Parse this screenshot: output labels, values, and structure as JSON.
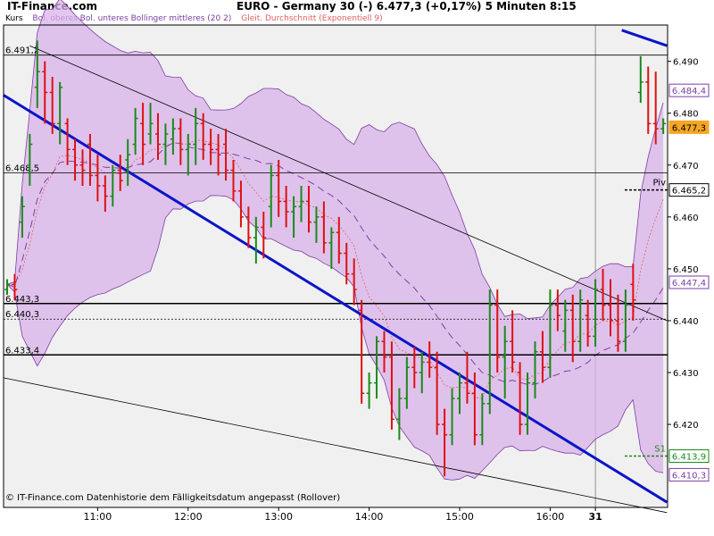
{
  "header": {
    "brand": "IT-Finance.com",
    "title": "EURO - Germany 30 (-)   6.477,3 (+0,17%)    5 Minuten  8:15"
  },
  "legend": [
    {
      "label": "Kurs",
      "color": "#000000"
    },
    {
      "label": "Bol. oberes Bol. unteres Bollinger mittleres (20 2)",
      "color": "#9933cc"
    },
    {
      "label": "Gleit. Durchschnitt (Exponentiell 9)",
      "color": "#e08080"
    }
  ],
  "footer": "© IT-Finance.com  Datenhistorie dem Fälligkeitsdatum angepasst (Rollover)",
  "colors": {
    "up": "#1a8a1a",
    "down": "#dd1111",
    "band_fill": "#d9b3ea",
    "band_line": "#7b3fa3",
    "ema": "#e06060",
    "trend": "#0a14c8",
    "plot_bg": "#f0f0f0",
    "last_price_bg": "#f5a623"
  },
  "chart_data": {
    "type": "candlestick",
    "ylim": [
      6404,
      6497
    ],
    "y_ticks": [
      "6.490",
      "6.480",
      "6.470",
      "6.460",
      "6.450",
      "6.440",
      "6.430",
      "6.420"
    ],
    "y_tick_values": [
      6490,
      6480,
      6470,
      6460,
      6450,
      6440,
      6430,
      6420
    ],
    "x_ticks": [
      "11:00",
      "12:00",
      "13:00",
      "14:00",
      "15:00",
      "16:00",
      "31"
    ],
    "x_tick_index": [
      12,
      24,
      36,
      48,
      60,
      72,
      78
    ],
    "levels": [
      {
        "label": "6.491,2",
        "value": 6491.2,
        "style": "solid"
      },
      {
        "label": "6.468,5",
        "value": 6468.5,
        "style": "solid"
      },
      {
        "label": "6.443,3",
        "value": 6443.3,
        "style": "solid-bold"
      },
      {
        "label": "6.440,3",
        "value": 6440.3,
        "style": "dotted"
      },
      {
        "label": "6.433,4",
        "value": 6433.4,
        "style": "solid-bold"
      }
    ],
    "right_labels": [
      {
        "label": "6.484,4",
        "value": 6484.4,
        "type": "upper-band"
      },
      {
        "label": "6.477,3",
        "value": 6477.3,
        "type": "last"
      },
      {
        "label": "6.465,2",
        "value": 6465.2,
        "type": "pivot",
        "tag": "Piv"
      },
      {
        "label": "6.447,4",
        "value": 6447.4,
        "type": "upper-band"
      },
      {
        "label": "6.413,9",
        "value": 6413.9,
        "type": "support",
        "tag": "S1"
      },
      {
        "label": "6.410,3",
        "value": 6410.3,
        "type": "lower-band"
      }
    ],
    "ohlc": [
      [
        6446,
        6448,
        6445,
        6447
      ],
      [
        6447,
        6449,
        6444,
        6446
      ],
      [
        6459,
        6464,
        6456,
        6462
      ],
      [
        6469,
        6476,
        6466,
        6474
      ],
      [
        6485,
        6494,
        6481,
        6488
      ],
      [
        6488,
        6490,
        6478,
        6484
      ],
      [
        6484,
        6487,
        6476,
        6478
      ],
      [
        6478,
        6486,
        6474,
        6485
      ],
      [
        6478,
        6479,
        6470,
        6473
      ],
      [
        6473,
        6475,
        6467,
        6470
      ],
      [
        6470,
        6473,
        6466,
        6469
      ],
      [
        6474,
        6476,
        6466,
        6468
      ],
      [
        6468,
        6472,
        6463,
        6466
      ],
      [
        6466,
        6468,
        6461,
        6464
      ],
      [
        6464,
        6470,
        6462,
        6469
      ],
      [
        6469,
        6472,
        6465,
        6467
      ],
      [
        6471,
        6475,
        6466,
        6472
      ],
      [
        6474,
        6481,
        6472,
        6479
      ],
      [
        6478,
        6482,
        6470,
        6474
      ],
      [
        6476,
        6482,
        6474,
        6478
      ],
      [
        6476,
        6480,
        6471,
        6474
      ],
      [
        6474,
        6478,
        6470,
        6476
      ],
      [
        6475,
        6479,
        6472,
        6477
      ],
      [
        6477,
        6479,
        6470,
        6473
      ],
      [
        6473,
        6476,
        6468,
        6474
      ],
      [
        6474,
        6481,
        6470,
        6478
      ],
      [
        6478,
        6480,
        6471,
        6474
      ],
      [
        6474,
        6477,
        6470,
        6473
      ],
      [
        6473,
        6476,
        6468,
        6472
      ],
      [
        6474,
        6477,
        6467,
        6469
      ],
      [
        6469,
        6471,
        6463,
        6465
      ],
      [
        6465,
        6467,
        6458,
        6460
      ],
      [
        6460,
        6462,
        6454,
        6456
      ],
      [
        6456,
        6460,
        6451,
        6458
      ],
      [
        6458,
        6461,
        6452,
        6456
      ],
      [
        6462,
        6470,
        6458,
        6468
      ],
      [
        6468,
        6471,
        6460,
        6463
      ],
      [
        6463,
        6466,
        6458,
        6461
      ],
      [
        6461,
        6464,
        6456,
        6462
      ],
      [
        6462,
        6466,
        6459,
        6463
      ],
      [
        6463,
        6466,
        6457,
        6459
      ],
      [
        6459,
        6462,
        6455,
        6460
      ],
      [
        6460,
        6463,
        6453,
        6455
      ],
      [
        6455,
        6458,
        6450,
        6457
      ],
      [
        6457,
        6460,
        6451,
        6453
      ],
      [
        6453,
        6455,
        6447,
        6449
      ],
      [
        6449,
        6452,
        6443,
        6446
      ],
      [
        6442,
        6444,
        6424,
        6426
      ],
      [
        6426,
        6430,
        6423,
        6428
      ],
      [
        6428,
        6437,
        6425,
        6436
      ],
      [
        6436,
        6438,
        6430,
        6433
      ],
      [
        6433,
        6436,
        6419,
        6421
      ],
      [
        6421,
        6427,
        6417,
        6425
      ],
      [
        6425,
        6433,
        6423,
        6431
      ],
      [
        6431,
        6435,
        6427,
        6430
      ],
      [
        6430,
        6434,
        6426,
        6432
      ],
      [
        6432,
        6436,
        6429,
        6431
      ],
      [
        6431,
        6434,
        6418,
        6420
      ],
      [
        6420,
        6423,
        6410,
        6418
      ],
      [
        6418,
        6427,
        6416,
        6425
      ],
      [
        6425,
        6430,
        6422,
        6428
      ],
      [
        6428,
        6434,
        6424,
        6426
      ],
      [
        6426,
        6430,
        6416,
        6418
      ],
      [
        6418,
        6426,
        6416,
        6424
      ],
      [
        6424,
        6446,
        6422,
        6443
      ],
      [
        6443,
        6446,
        6430,
        6433
      ],
      [
        6433,
        6439,
        6425,
        6436
      ],
      [
        6436,
        6442,
        6430,
        6432
      ],
      [
        6430,
        6432,
        6418,
        6420
      ],
      [
        6420,
        6430,
        6418,
        6428
      ],
      [
        6428,
        6436,
        6425,
        6434
      ],
      [
        6434,
        6438,
        6428,
        6431
      ],
      [
        6431,
        6446,
        6429,
        6443
      ],
      [
        6443,
        6446,
        6438,
        6441
      ],
      [
        6438,
        6444,
        6434,
        6442
      ],
      [
        6442,
        6445,
        6432,
        6436
      ],
      [
        6436,
        6446,
        6434,
        6444
      ],
      [
        6441,
        6444,
        6435,
        6437
      ],
      [
        6437,
        6448,
        6435,
        6446
      ],
      [
        6446,
        6450,
        6440,
        6443
      ],
      [
        6443,
        6448,
        6437,
        6440
      ],
      [
        6440,
        6445,
        6434,
        6436
      ],
      [
        6436,
        6446,
        6434,
        6443
      ],
      [
        6447,
        6451,
        6440,
        6444
      ],
      [
        6484,
        6491,
        6482,
        6486
      ],
      [
        6486,
        6489,
        6476,
        6478
      ],
      [
        6478,
        6488,
        6474,
        6477
      ],
      [
        6477,
        6479,
        6476,
        6478
      ]
    ]
  }
}
